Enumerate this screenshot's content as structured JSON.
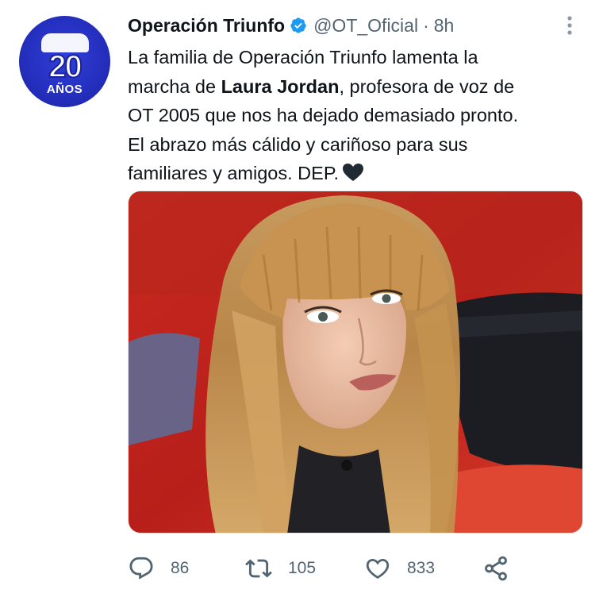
{
  "account": {
    "name": "Operación Triunfo",
    "handle": "@OT_Oficial",
    "separator": "·",
    "time": "8h",
    "avatar_text_main": "20",
    "avatar_text_sub": "AÑOS"
  },
  "tweet": {
    "line1": "La familia de Operación Triunfo lamenta la",
    "line2_pre": "marcha de ",
    "line2_bold": "Laura Jordan",
    "line2_post": ", profesora de voz de",
    "line3": "OT 2005 que nos ha dejado demasiado pronto.",
    "line4": "El abrazo más cálido y cariñoso para sus",
    "line5": "familiares y amigos. DEP."
  },
  "actions": {
    "replies": "86",
    "retweets": "105",
    "likes": "833"
  },
  "icons": [
    "verified-badge-icon",
    "more-options-icon",
    "black-heart-emoji-icon",
    "reply-icon",
    "retweet-icon",
    "like-icon",
    "share-icon"
  ],
  "colors": {
    "verified": "#1d9bf0",
    "secondary_text": "#536471",
    "avatar_blue": "#2530c0"
  }
}
